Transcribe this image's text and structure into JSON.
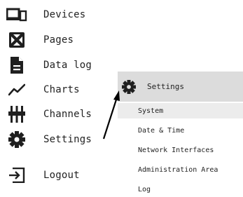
{
  "nav": {
    "items": [
      {
        "label": "Devices",
        "icon": "devices-icon"
      },
      {
        "label": "Pages",
        "icon": "pages-icon"
      },
      {
        "label": "Data log",
        "icon": "file-icon"
      },
      {
        "label": "Charts",
        "icon": "chart-line-icon"
      },
      {
        "label": "Channels",
        "icon": "channels-icon"
      },
      {
        "label": "Settings",
        "icon": "gear-icon"
      },
      {
        "label": "Logout",
        "icon": "logout-icon"
      }
    ]
  },
  "submenu": {
    "title": "Settings",
    "icon": "gear-icon",
    "items": [
      {
        "label": "System",
        "active": true
      },
      {
        "label": "Date & Time"
      },
      {
        "label": "Network Interfaces"
      },
      {
        "label": "Administration Area"
      },
      {
        "label": "Log"
      }
    ]
  },
  "colors": {
    "icon": "#1f1f1f",
    "submenu_header_bg": "#dcdcdc",
    "submenu_active_bg": "#ececec"
  }
}
